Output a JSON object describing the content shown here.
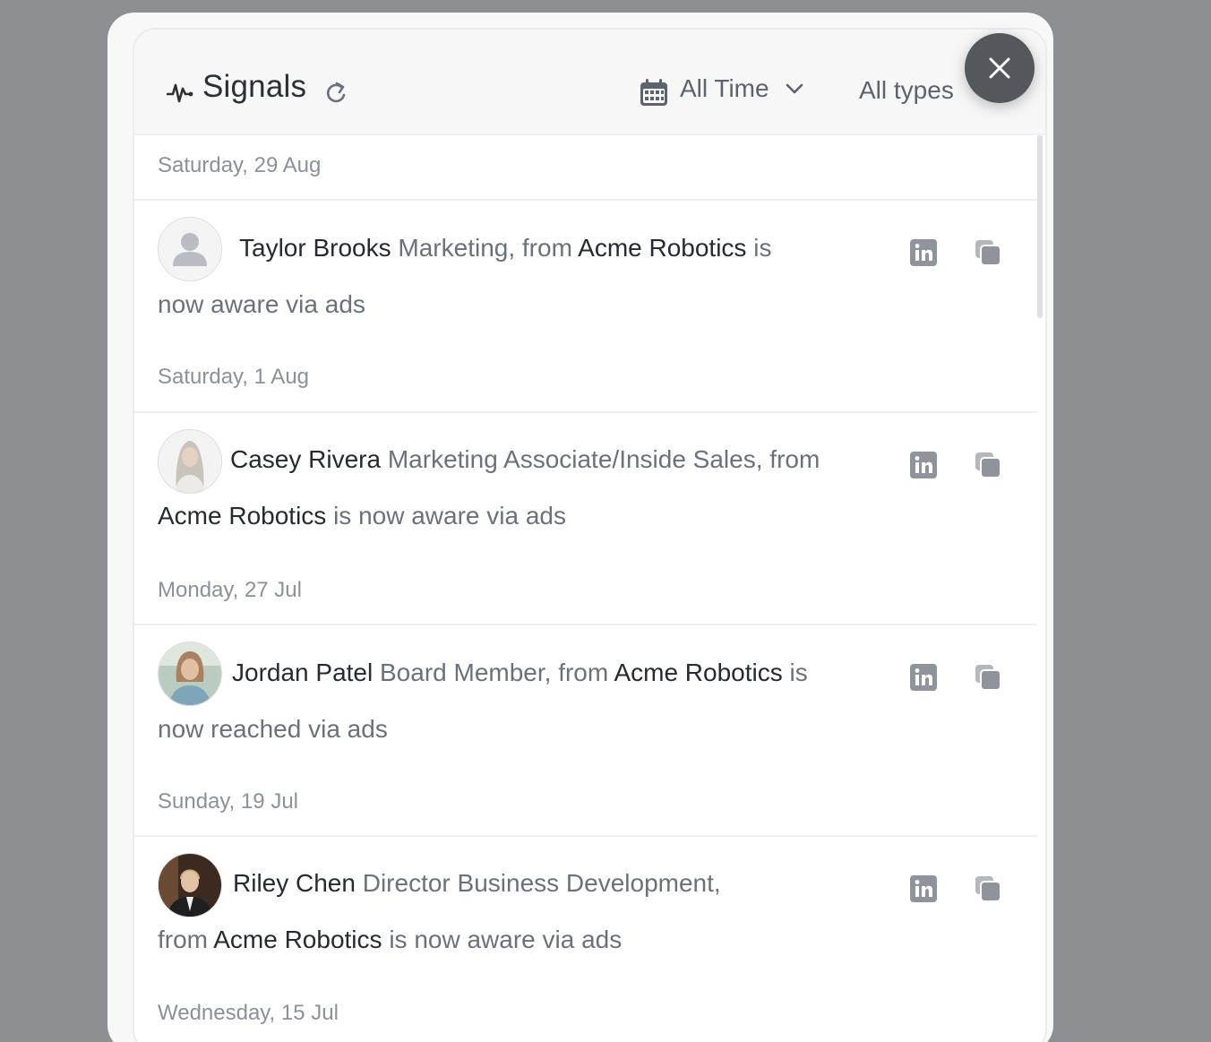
{
  "header": {
    "title": "Signals",
    "date_range": "All Time",
    "type_filter": "All types"
  },
  "feed": [
    {
      "date": "Saturday, 29 Aug",
      "name": "Taylor Brooks",
      "role": "Marketing, from",
      "company": "Acme Robotics",
      "suffix_line1": "is",
      "suffix_line2": "now aware via ads",
      "avatar": "placeholder-icon"
    },
    {
      "date": "Saturday, 1 Aug",
      "name": "Casey Rivera",
      "role": "Marketing Associate/Inside Sales, from",
      "company": "Acme Robotics",
      "suffix": "is now aware via ads",
      "avatar": "photo"
    },
    {
      "date": "Monday, 27 Jul",
      "name": "Jordan Patel",
      "role": "Board Member, from",
      "company": "Acme Robotics",
      "suffix_line1": "is",
      "suffix_line2": "now reached via ads",
      "avatar": "photo"
    },
    {
      "date": "Sunday, 19 Jul",
      "name": "Riley Chen",
      "role_line1": "Director Business Development,",
      "role_line2": "from",
      "company": "Acme Robotics",
      "suffix": "is now aware via ads",
      "avatar": "photo"
    },
    {
      "date": "Wednesday, 15 Jul"
    }
  ],
  "colors": {
    "backdrop": "#8e8f93",
    "panel": "#ffffff",
    "name_text": "#262a31",
    "body_text": "#6b717c",
    "date_text": "#8b919b",
    "action_icon": "#8f949c",
    "close_button": "#54575c"
  }
}
